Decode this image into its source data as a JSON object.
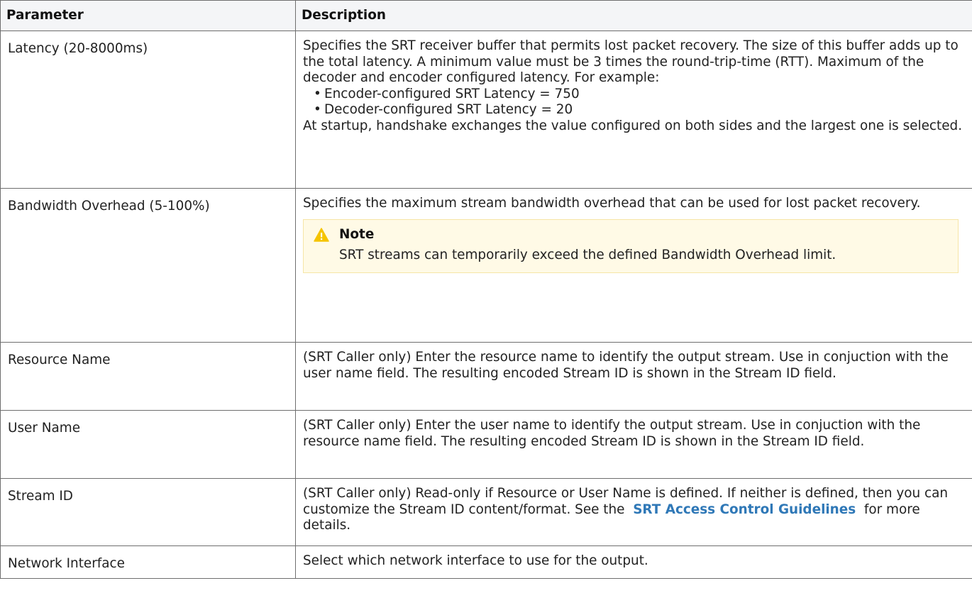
{
  "table": {
    "headers": {
      "parameter": "Parameter",
      "description": "Description"
    },
    "rows": [
      {
        "parameter": "Latency (20-8000ms)",
        "description": "Specifies the SRT receiver buffer that permits lost packet recovery. The size of this buffer adds up to the total latency. A minimum value must be 3 times the round-trip-time (RTT). Maximum of the decoder and encoder configured latency. For example:",
        "bullets": [
          "Encoder-configured SRT Latency = 750",
          "Decoder-configured SRT Latency = 20"
        ],
        "after": "At startup, handshake exchanges the value configured on both sides and the largest one is selected."
      },
      {
        "parameter": "Bandwidth Overhead (5-100%)",
        "description": "Specifies the maximum stream bandwidth overhead that can be used for lost packet recovery.",
        "note": {
          "icon": "warning-icon",
          "title": "Note",
          "text": "SRT streams can temporarily exceed the defined Bandwidth Overhead limit."
        }
      },
      {
        "parameter": "Resource Name",
        "description": "(SRT Caller only) Enter the resource name to identify the output stream. Use in conjuction with the user name field. The resulting encoded Stream ID is shown in the Stream ID field."
      },
      {
        "parameter": "User Name",
        "description": "(SRT Caller only) Enter the user name to identify the output stream. Use in conjuction with the resource name field. The resulting encoded Stream ID is shown in the Stream ID field."
      },
      {
        "parameter": "Stream ID",
        "description_before": "(SRT Caller only) Read-only if Resource or User Name is defined. If neither is defined, then you can customize the Stream ID content/format. See the",
        "link_text": "SRT Access Control Guidelines",
        "description_after": "for more details."
      },
      {
        "parameter": "Network Interface",
        "description": "Select which network interface to use for the output."
      }
    ]
  },
  "colors": {
    "link": "#2f78b7",
    "note_background": "#fffae6",
    "note_border": "#f6e5a6",
    "warning_icon": "#f5c400",
    "header_background": "#f4f5f7"
  }
}
